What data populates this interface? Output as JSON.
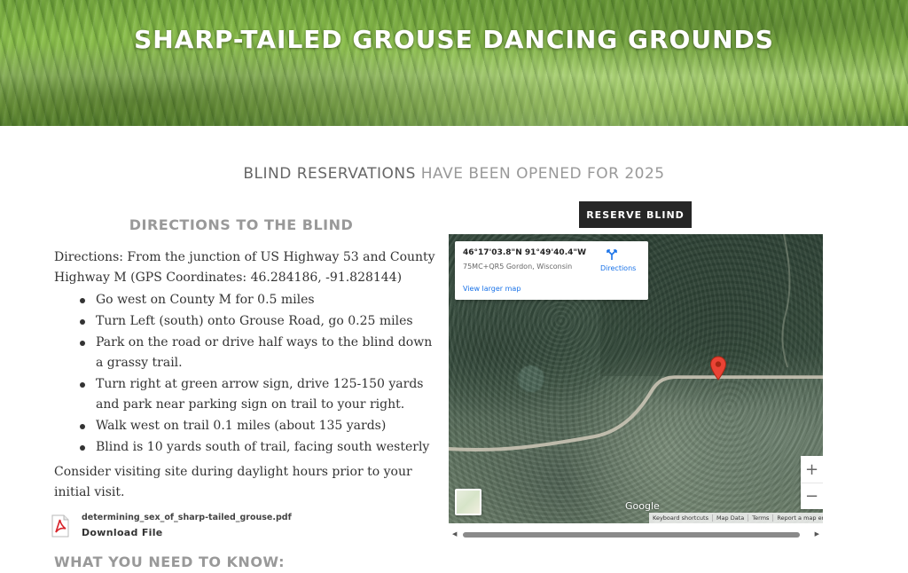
{
  "banner": {
    "title": "SHARP-TAILED GROUSE DANCING GROUNDS"
  },
  "announcement": {
    "strong": "BLIND RESERVATIONS",
    "light": " HAVE BEEN OPENED FOR 2025"
  },
  "directions": {
    "heading": "DIRECTIONS TO THE BLIND",
    "intro": "Directions: From the junction of US Highway 53 and County Highway M  (GPS Coordinates: 46.284186, -91.828144)",
    "steps": [
      "Go west on County M for 0.5 miles",
      "Turn Left (south) onto Grouse Road, go 0.25 miles",
      "Park on the road or drive half ways to the blind down a grassy trail.",
      "Turn right at green arrow sign, drive 125-150 yards and park near parking sign on trail to your right.",
      "Walk west on trail 0.1 miles (about 135 yards)",
      "Blind is 10 yards south of trail, facing south westerly"
    ],
    "consider": "Consider visiting site during daylight hours prior to your initial visit."
  },
  "pdf": {
    "filename": "determining_sex_of_sharp-tailed_grouse.pdf",
    "download_label": "Download File",
    "icon": "pdf-file-icon"
  },
  "need_heading": "WHAT YOU NEED TO KNOW:",
  "reserve_button": {
    "label": "RESERVE BLIND"
  },
  "map": {
    "coords": "46°17'03.8\"N 91°49'40.4\"W",
    "address": "75MC+QR5 Gordon, Wisconsin",
    "directions_label": "Directions",
    "larger_map": "View larger map",
    "zoom_in": "+",
    "zoom_out": "−",
    "logo": "Google",
    "attributions": [
      "Keyboard shortcuts",
      "Map Data",
      "Terms",
      "Report a map error"
    ],
    "pin_color": "#ea4335",
    "link_color": "#1a73e8"
  },
  "scroll": {
    "left_arrow": "◀",
    "right_arrow": "▶"
  }
}
